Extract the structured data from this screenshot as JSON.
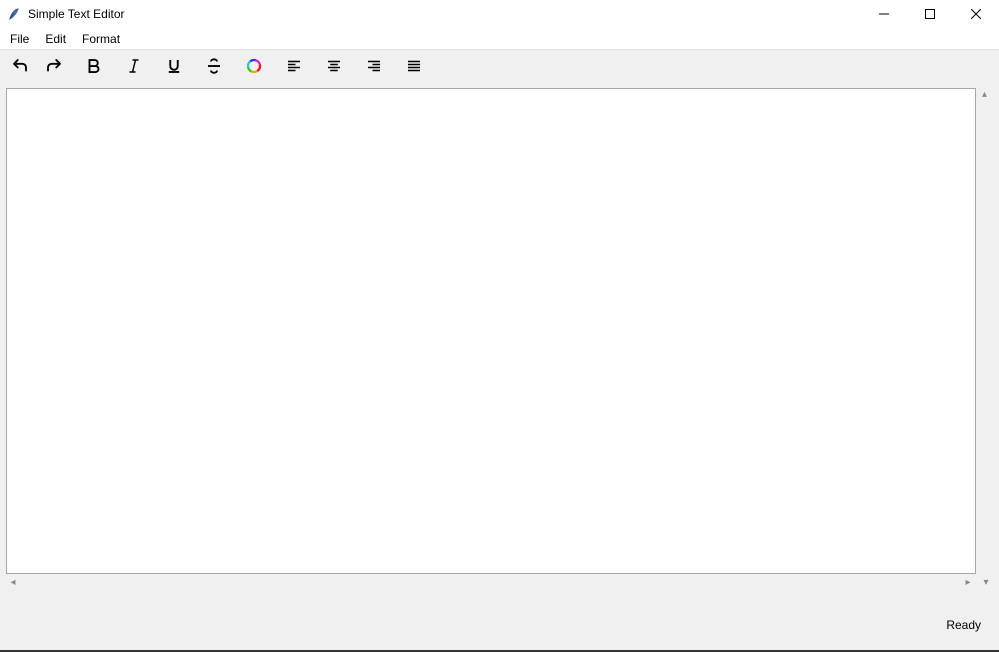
{
  "window": {
    "title": "Simple Text Editor"
  },
  "menubar": {
    "items": [
      {
        "label": "File"
      },
      {
        "label": "Edit"
      },
      {
        "label": "Format"
      }
    ]
  },
  "toolbar": {
    "icons": {
      "undo": "undo-icon",
      "redo": "redo-icon",
      "bold": "bold-icon",
      "italic": "italic-icon",
      "underline": "underline-icon",
      "strikethrough": "strikethrough-icon",
      "color": "color-wheel-icon",
      "align_left": "align-left-icon",
      "align_center": "align-center-icon",
      "align_right": "align-right-icon",
      "align_justify": "align-justify-icon"
    }
  },
  "editor": {
    "content": "",
    "placeholder": ""
  },
  "status": {
    "text": "Ready"
  }
}
